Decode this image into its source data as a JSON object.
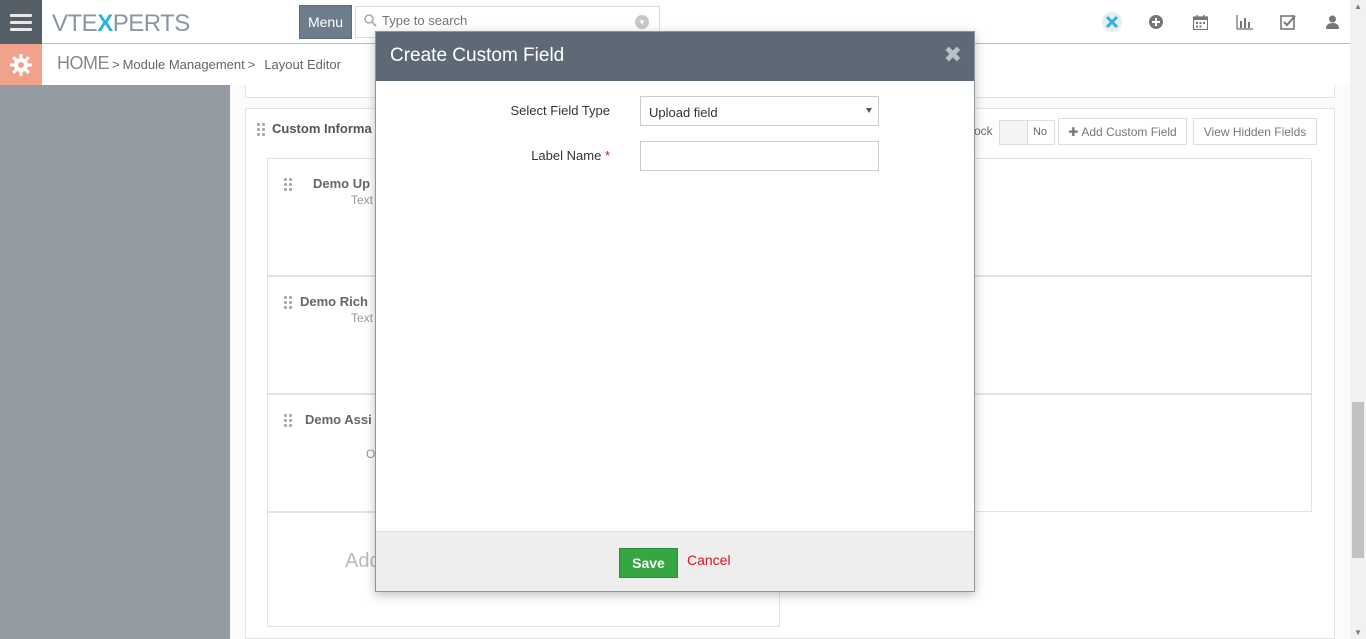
{
  "header": {
    "logo_prefix": "VTE",
    "logo_x": "X",
    "logo_suffix": "PERTS",
    "menu_label": "Menu",
    "search_placeholder": "Type to search"
  },
  "breadcrumb": {
    "home": "HOME",
    "sep1": ">",
    "module_management": "Module Management",
    "sep2": ">",
    "layout_editor": "Layout Editor"
  },
  "background": {
    "block_title": "Custom Informa",
    "lock_text": "ock",
    "toggle_label": "No",
    "add_custom_field": "Add Custom Field",
    "view_hidden_fields": "View Hidden Fields",
    "fields": [
      {
        "name": "Demo Up",
        "type": "Text"
      },
      {
        "name": "Demo Rich",
        "type": "Text"
      },
      {
        "name": "Demo Assi",
        "type": "O"
      }
    ],
    "add_text": "Add"
  },
  "modal": {
    "title": "Create Custom Field",
    "close_glyph": "✖",
    "field_type_label": "Select Field Type",
    "field_type_value": "Upload field",
    "label_name_label": "Label Name",
    "required_mark": "*",
    "label_name_value": "",
    "save_label": "Save",
    "cancel_label": "Cancel"
  },
  "colors": {
    "header_bg": "#5d6a75",
    "accent_orange": "#f0a38a",
    "save_green": "#35a642",
    "cancel_red": "#d9161d",
    "logo_blue": "#2fb3d9"
  }
}
